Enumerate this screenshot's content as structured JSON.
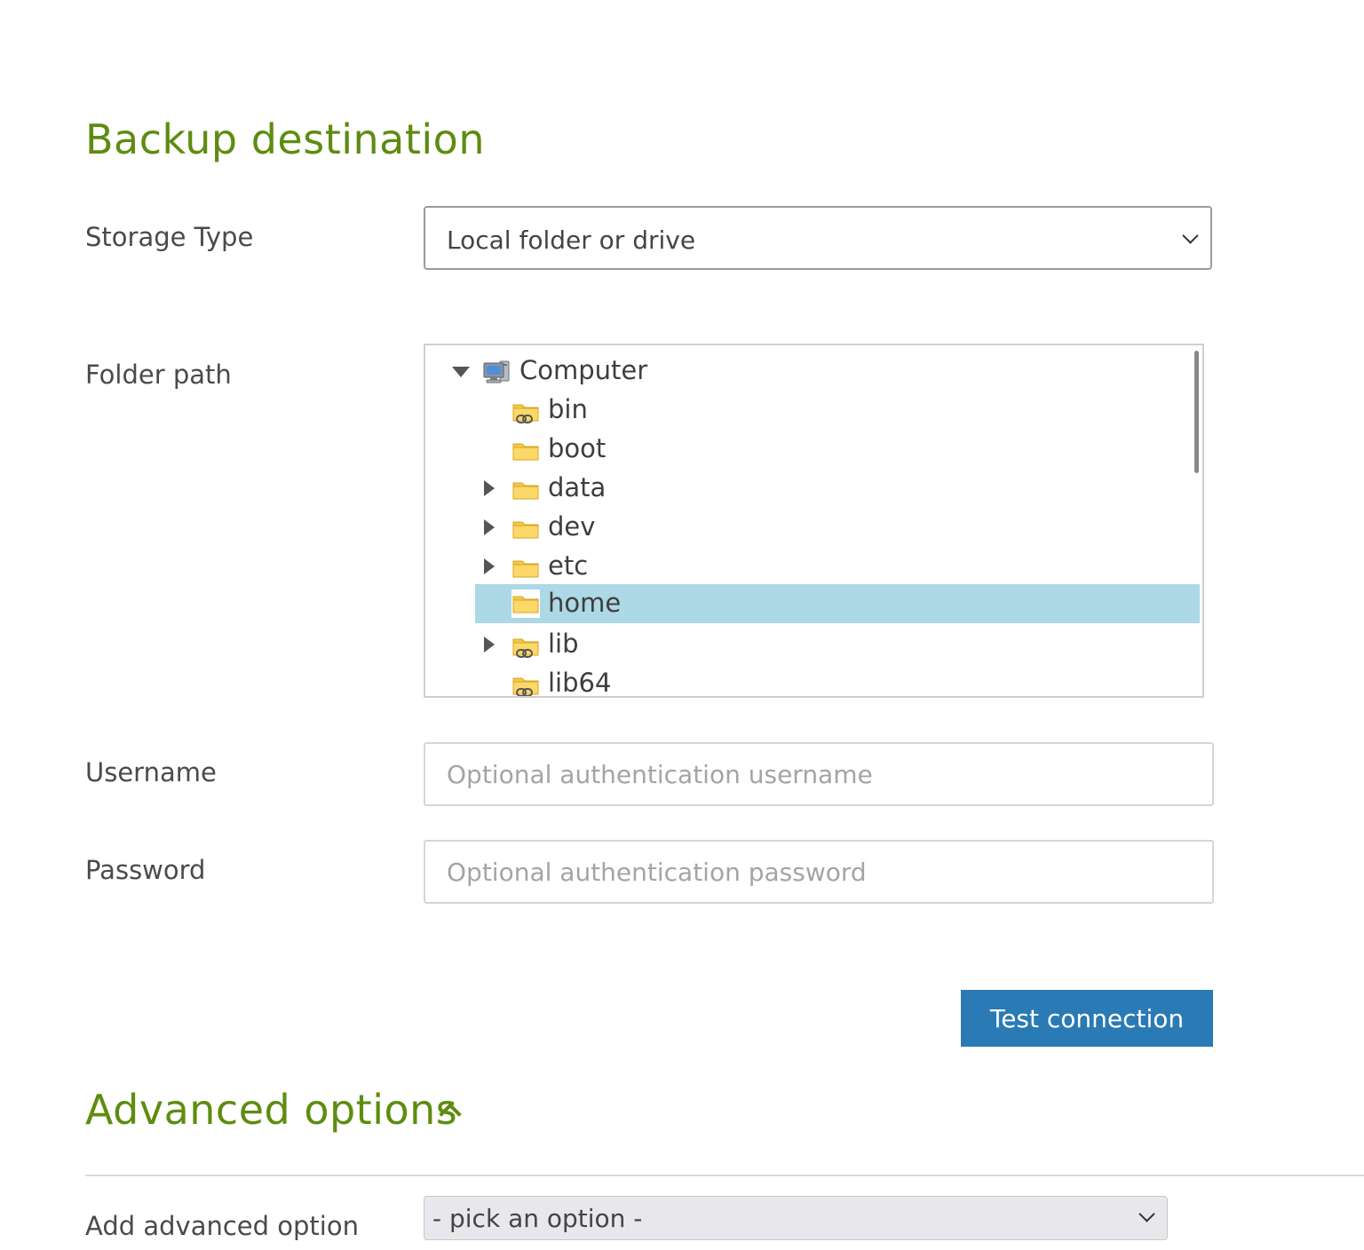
{
  "destination": {
    "title": "Backup destination",
    "storage_type": {
      "label": "Storage Type",
      "selected": "Local folder or drive"
    },
    "folder_path": {
      "label": "Folder path",
      "tree": [
        {
          "label": "Computer",
          "icon": "computer-icon",
          "expanded": true
        },
        {
          "label": "bin",
          "icon": "folder-link-icon"
        },
        {
          "label": "boot",
          "icon": "folder-icon"
        },
        {
          "label": "data",
          "icon": "folder-icon",
          "expandable": true
        },
        {
          "label": "dev",
          "icon": "folder-icon",
          "expandable": true
        },
        {
          "label": "etc",
          "icon": "folder-icon",
          "expandable": true
        },
        {
          "label": "home",
          "icon": "folder-icon",
          "selected": true
        },
        {
          "label": "lib",
          "icon": "folder-link-icon",
          "expandable": true
        },
        {
          "label": "lib64",
          "icon": "folder-link-icon"
        }
      ],
      "selection_color": "#add8e6"
    },
    "username": {
      "label": "Username",
      "placeholder": "Optional authentication username"
    },
    "password": {
      "label": "Password",
      "placeholder": "Optional authentication password"
    },
    "test_button": "Test connection"
  },
  "advanced": {
    "title": "Advanced options",
    "add_label": "Add advanced option",
    "select_value": "- pick an option -"
  },
  "colors": {
    "heading": "#5e8c10",
    "button": "#2a7ab5",
    "folder": "#f4c94a"
  }
}
